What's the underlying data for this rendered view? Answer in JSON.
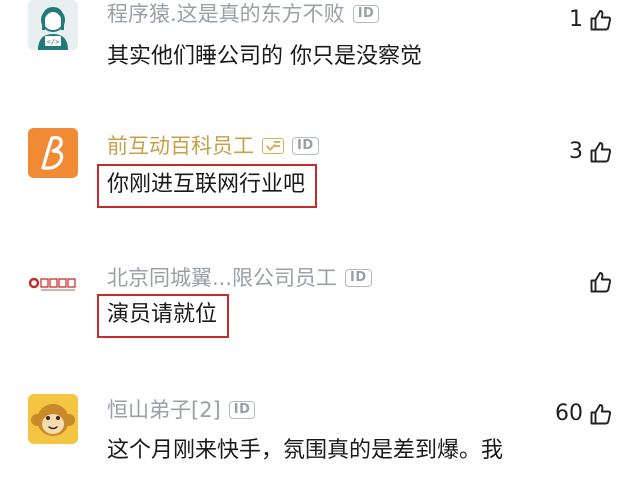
{
  "comments": [
    {
      "name": "程序猿.这是真的东方不败",
      "id_badge": "ID",
      "content": "其实他们睡公司的 你只是没察觉",
      "likes": "1",
      "avatar_icon": "programmer-avatar-icon"
    },
    {
      "name": "前互动百科员工",
      "id_badge": "ID",
      "content": "你刚进互联网行业吧",
      "likes": "3",
      "avatar_icon": "baike-logo-avatar-icon"
    },
    {
      "name": "北京同城翼...限公司员工",
      "id_badge": "ID",
      "content": "演员请就位",
      "likes": "",
      "avatar_icon": "company-logo-avatar-icon"
    },
    {
      "name": "恒山弟子[2]",
      "id_badge": "ID",
      "content": "这个月刚来快手，氛围真的是差到爆。我",
      "likes": "60",
      "avatar_icon": "monkey-avatar-icon"
    }
  ],
  "colors": {
    "name_gray": "#9aa0a6",
    "name_gold": "#c9a04a",
    "highlight_box": "#c72b2b"
  }
}
